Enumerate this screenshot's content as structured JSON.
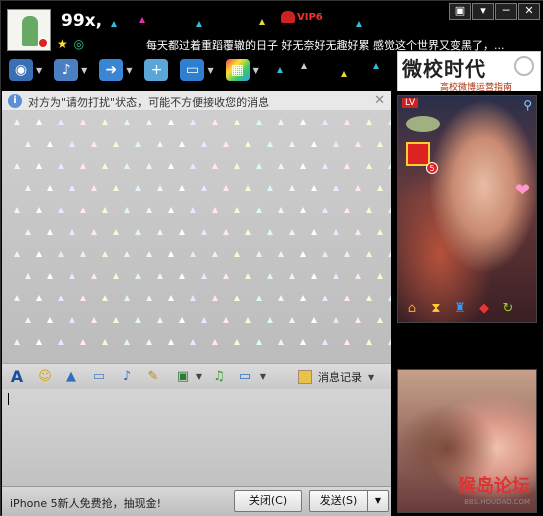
{
  "header": {
    "nickname": "99x,",
    "vip_label": "VIP6",
    "signature": "每天都过着重蹈覆辙的日子 好无奈好无趣好累 感觉这个世界又变黑了，..."
  },
  "window_buttons": [
    "▣",
    "▾",
    "─",
    "✕"
  ],
  "toolbar_icons": [
    "webcam-icon",
    "microphone-icon",
    "file-transfer-icon",
    "add-chat-icon",
    "screen-share-icon",
    "apps-icon"
  ],
  "ad_top": {
    "title": "微校时代",
    "subtitle": "高校微博运营指南"
  },
  "notice": {
    "text": "对方为\"请勿打扰\"状态，可能不方便接收您的消息"
  },
  "edit_toolbar": {
    "history_label": "消息记录"
  },
  "bottom": {
    "promo": "iPhone 5新人免费抢，抽现金!",
    "close_label": "关闭(C)",
    "send_label": "发送(S)",
    "send_dropdown": "▼"
  },
  "right_panel": {
    "level_badge": "LV",
    "gift_count": "5",
    "watermark_main": "猴岛论坛",
    "watermark_sub": "BBS.HOUDAO.COM"
  },
  "colors": {
    "accent": "#5b8fd6",
    "vip": "#e33",
    "gift": "#d22"
  }
}
